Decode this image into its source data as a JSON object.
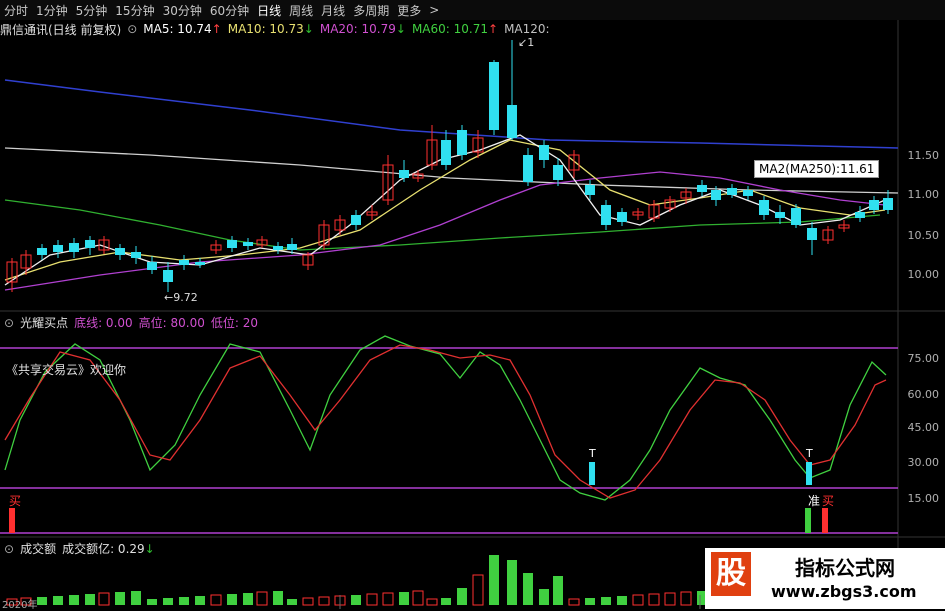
{
  "tabs": [
    "分时",
    "1分钟",
    "5分钟",
    "15分钟",
    "30分钟",
    "60分钟",
    "日线",
    "周线",
    "月线",
    "多周期",
    "更多"
  ],
  "active_tab": "日线",
  "stock_title": "鼎信通讯(日线 前复权)",
  "ma": [
    {
      "label": "MA5: 10.74",
      "arrow": "↑",
      "color": "#ffffff"
    },
    {
      "label": "MA10: 10.73",
      "arrow": "↓",
      "color": "#e8e070"
    },
    {
      "label": "MA20: 10.79",
      "arrow": "↓",
      "color": "#d050d0"
    },
    {
      "label": "MA60: 10.71",
      "arrow": "↑",
      "color": "#40d040"
    },
    {
      "label": "MA120:",
      "arrow": "",
      "color": "#c0c0c0"
    }
  ],
  "tooltip": "MA2(MA250):11.61",
  "price_low_label": "9.72",
  "price_high_mark": "1",
  "price_axis": [
    "11.50",
    "11.00",
    "10.50",
    "10.00"
  ],
  "colors": {
    "up": "#ff3030",
    "down": "#30e0f0",
    "ma5": "#f0f0f0",
    "ma10": "#e8e070",
    "ma20": "#b040d0",
    "ma60": "#30b030",
    "ma120": "#d0d0d0",
    "ma250": "#3040d0",
    "k": "#40d040",
    "d": "#e03030",
    "band": "#b040d0"
  },
  "indicator": {
    "name": "光耀买点",
    "params": [
      {
        "label": "底线: 0.00",
        "color": "#d050d0"
      },
      {
        "label": "高位: 80.00",
        "color": "#d050d0"
      },
      {
        "label": "低位: 20",
        "color": "#d050d0"
      }
    ],
    "promo": "《共享交易云》欢迎你",
    "axis": [
      "75.00",
      "60.00",
      "45.00",
      "30.00",
      "15.00"
    ],
    "t_mark": "T",
    "buy_label": "买",
    "ready_label": "准"
  },
  "volume": {
    "name": "成交额",
    "label": "成交额亿: 0.29",
    "arrow": "↓",
    "date_label": "2020年"
  },
  "watermark": {
    "logo_char": "股",
    "title": "指标公式网",
    "url": "www.zbgs3.com"
  }
}
